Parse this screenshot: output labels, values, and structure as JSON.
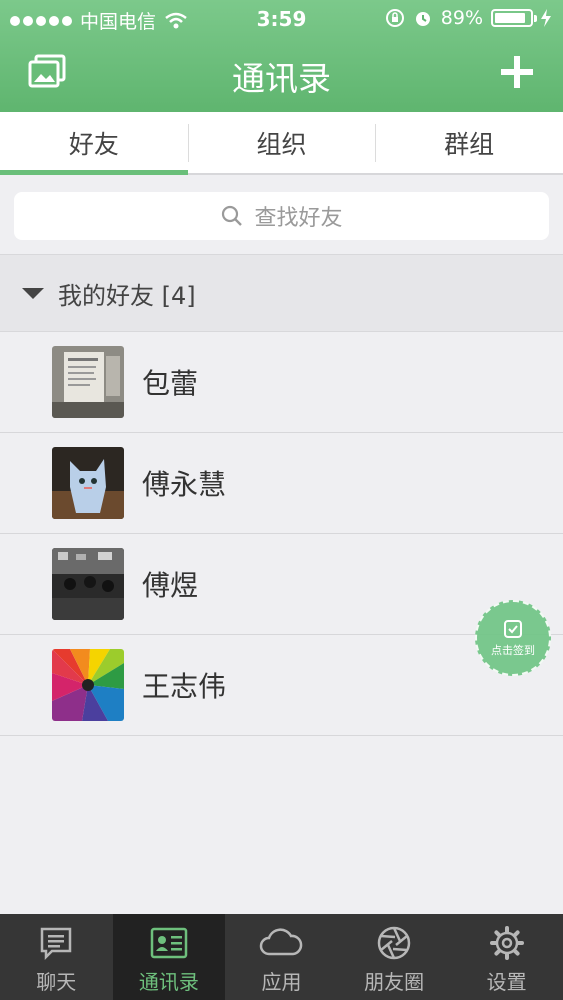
{
  "status_bar": {
    "carrier": "中国电信",
    "time": "3:59",
    "battery": "89%",
    "battery_level": 0.89
  },
  "nav": {
    "title": "通讯录",
    "left_icon": "gallery-icon",
    "right_icon": "plus-icon"
  },
  "tabs": [
    {
      "label": "好友",
      "active": true
    },
    {
      "label": "组织",
      "active": false
    },
    {
      "label": "群组",
      "active": false
    }
  ],
  "search": {
    "placeholder": "查找好友"
  },
  "group": {
    "title": "我的好友 [4]"
  },
  "contacts": [
    {
      "name": "包蕾"
    },
    {
      "name": "傅永慧"
    },
    {
      "name": "傅煜"
    },
    {
      "name": "王志伟"
    }
  ],
  "floating": {
    "label": "点击签到"
  },
  "tabbar": [
    {
      "label": "聊天",
      "icon": "chat-icon",
      "active": false
    },
    {
      "label": "通讯录",
      "icon": "contacts-icon",
      "active": true
    },
    {
      "label": "应用",
      "icon": "cloud-icon",
      "active": false
    },
    {
      "label": "朋友圈",
      "icon": "aperture-icon",
      "active": false
    },
    {
      "label": "设置",
      "icon": "gear-icon",
      "active": false
    }
  ],
  "colors": {
    "brand_green": "#6abf7a",
    "tabbar_bg": "#363636"
  }
}
